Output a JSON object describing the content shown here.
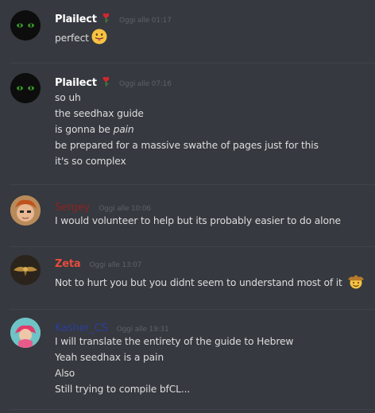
{
  "messages": [
    {
      "author": "Plailect",
      "author_color": "#ffffff",
      "badge_icon": "rose-icon",
      "timestamp": "Oggi alle 01:17",
      "lines": [
        "perfect"
      ],
      "line_emoji": "tongue-face-emoji"
    },
    {
      "author": "Plailect",
      "author_color": "#ffffff",
      "badge_icon": "rose-icon",
      "timestamp": "Oggi alle 07:16",
      "lines": [
        "so uh",
        "the seedhax guide",
        "is gonna be ",
        "be prepared for a massive swathe of pages just for this",
        "it's so complex"
      ],
      "italic_word": "pain"
    },
    {
      "author": "Sergey",
      "author_color": "#8b2323",
      "timestamp": "Oggi alle 10:06",
      "lines": [
        "I would volunteer to help but its probably easier to do alone"
      ]
    },
    {
      "author": "Zeta",
      "author_color": "#e74c3c",
      "timestamp": "Oggi alle 13:07",
      "lines": [
        "Not to hurt you but you didnt seem to understand most of it"
      ],
      "line_emoji": "cowboy-face-emoji"
    },
    {
      "author": "Kasher_CS",
      "author_color": "#2c3e9a",
      "timestamp": "Oggi alle 19:31",
      "lines": [
        "I will translate the entirety of the guide to Hebrew",
        "Yeah seedhax is a pain",
        "Also",
        "Still trying to compile bfCL..."
      ]
    }
  ]
}
